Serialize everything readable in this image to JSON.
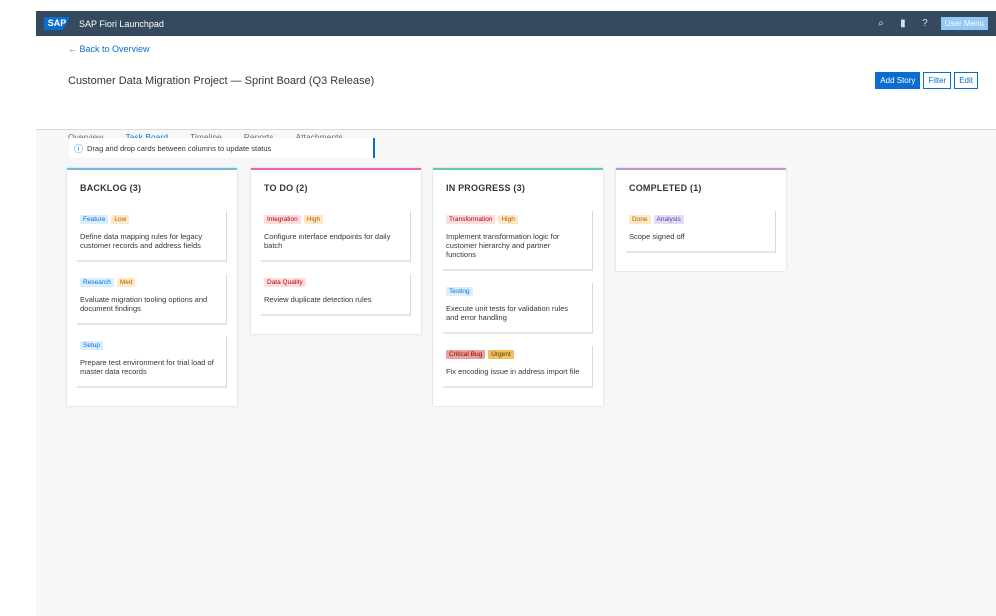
{
  "shell": {
    "title": "SAP Fiori Launchpad",
    "user_label": "User Menu"
  },
  "header": {
    "back_label": "← Back to Overview",
    "title": "Customer Data Migration Project — Sprint Board (Q3 Release)",
    "actions": {
      "primary": "Add Story",
      "secondary": "Filter",
      "edit": "Edit"
    }
  },
  "tabs": [
    "Overview",
    "Task Board",
    "Timeline",
    "Reports",
    "Attachments"
  ],
  "info_text": "Drag and drop cards between columns to update status",
  "columns": [
    {
      "title": "BACKLOG (3)",
      "accent": "#72bbe9",
      "cards": [
        {
          "tags": [
            {
              "t": "Feature",
              "bg": "#d7efff",
              "fg": "#0a6ed1"
            },
            {
              "t": "Low",
              "bg": "#ffe8c6",
              "fg": "#b06000"
            }
          ],
          "text": "Define data mapping rules for legacy customer records and address fields"
        },
        {
          "tags": [
            {
              "t": "Research",
              "bg": "#d7efff",
              "fg": "#0a6ed1"
            },
            {
              "t": "Med",
              "bg": "#ffe8c6",
              "fg": "#b06000"
            }
          ],
          "text": "Evaluate migration tooling options and document findings"
        },
        {
          "tags": [
            {
              "t": "Setup",
              "bg": "#d7efff",
              "fg": "#0a6ed1"
            }
          ],
          "text": "Prepare test environment for trial load of master data records"
        }
      ]
    },
    {
      "title": "TO DO (2)",
      "accent": "#e464b8",
      "cards": [
        {
          "tags": [
            {
              "t": "Integration",
              "bg": "#fcdde0",
              "fg": "#bb0000"
            },
            {
              "t": "High",
              "bg": "#ffe8c6",
              "fg": "#b06000"
            }
          ],
          "text": "Configure interface endpoints for daily batch"
        },
        {
          "tags": [
            {
              "t": "Data Quality",
              "bg": "#fcdde0",
              "fg": "#bb0000"
            }
          ],
          "text": "Review duplicate detection rules"
        }
      ]
    },
    {
      "title": "IN PROGRESS (3)",
      "accent": "#64c8b8",
      "cards": [
        {
          "tags": [
            {
              "t": "Transformation",
              "bg": "#fcdde0",
              "fg": "#bb0000"
            },
            {
              "t": "High",
              "bg": "#ffe8c6",
              "fg": "#b06000"
            }
          ],
          "text": "Implement transformation logic for customer hierarchy and partner functions"
        },
        {
          "tags": [
            {
              "t": "Testing",
              "bg": "#d7efff",
              "fg": "#0a6ed1"
            }
          ],
          "text": "Execute unit tests for validation rules and error handling"
        },
        {
          "tags": [
            {
              "t": "Critical Bug",
              "bg": "#e8a0a0",
              "fg": "#8a0000"
            },
            {
              "t": "Urgent",
              "bg": "#f0c060",
              "fg": "#5a3a00"
            }
          ],
          "text": "Fix encoding issue in address import file"
        }
      ]
    },
    {
      "title": "COMPLETED (1)",
      "accent": "#b99ad6",
      "cards": [
        {
          "tags": [
            {
              "t": "Done",
              "bg": "#ffe8c6",
              "fg": "#b06000"
            },
            {
              "t": "Analysis",
              "bg": "#e3dcf5",
              "fg": "#5d36b8"
            }
          ],
          "text": "Scope signed off"
        }
      ]
    }
  ]
}
